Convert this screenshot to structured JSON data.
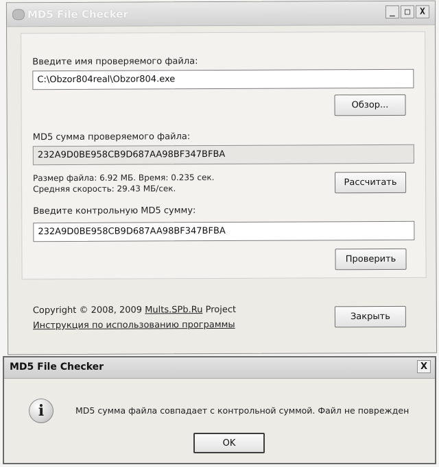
{
  "window": {
    "title": "MD5 File Checker",
    "minimize_glyph": "_",
    "maximize_glyph": "□",
    "close_glyph": "X"
  },
  "form": {
    "file_label": "Введите имя проверяемого файла:",
    "file_value": "C:\\Obzor804real\\Obzor804.exe",
    "browse_button": "Обзор...",
    "md5_label": "MD5 сумма проверяемого файла:",
    "md5_value": "232A9D0BE958CB9D687AA98BF347BFBA",
    "stats_line1": "Размер файла: 6.92 МБ. Время: 0.235 сек.",
    "stats_line2": "Средняя скорость: 29.43 МБ/сек.",
    "calculate_button": "Рассчитать",
    "control_label": "Введите контрольную MD5 сумму:",
    "control_value": "232A9D0BE958CB9D687AA98BF347BFBA",
    "verify_button": "Проверить"
  },
  "footer": {
    "copyright_prefix": "Copyright © 2008, 2009 ",
    "copyright_link": "Mults.SPb.Ru",
    "copyright_suffix": " Project",
    "manual_link": "Инструкция по использованию программы",
    "close_button": "Закрыть"
  },
  "dialog": {
    "title": "MD5 File Checker",
    "close_glyph": "X",
    "icon": "info-icon",
    "message": "MD5 сумма файла совпадает с контрольной суммой. Файл не поврежден",
    "ok_button": "OK"
  }
}
